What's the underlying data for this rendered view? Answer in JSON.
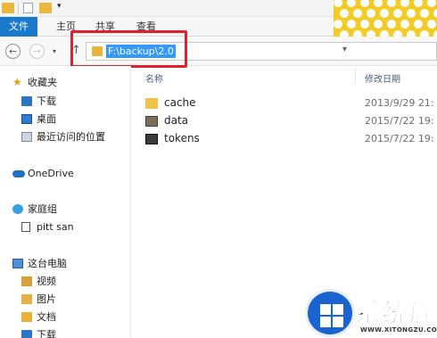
{
  "ribbon": {
    "tabs": [
      "文件",
      "主页",
      "共享",
      "查看"
    ]
  },
  "address": {
    "path": "F:\\backup\\2.0"
  },
  "nav_pane": {
    "favorites": {
      "label": "收藏夹",
      "items": [
        "下载",
        "桌面",
        "最近访问的位置"
      ]
    },
    "onedrive": "OneDrive",
    "homegroup": {
      "label": "家庭组",
      "items": [
        "pitt san"
      ]
    },
    "this_pc": {
      "label": "这台电脑",
      "items": [
        "视频",
        "图片",
        "文档",
        "下载"
      ]
    }
  },
  "columns": {
    "name": "名称",
    "date_modified": "修改日期"
  },
  "files": [
    {
      "name": "cache",
      "date": "2013/9/29 21:",
      "icon": "folder-icon"
    },
    {
      "name": "data",
      "date": "2015/7/22 19:",
      "icon": "data-file-icon"
    },
    {
      "name": "tokens",
      "date": "2015/7/22 19:",
      "icon": "tokens-file-icon"
    }
  ],
  "watermark": {
    "title": "系统族",
    "url": "WWW.XITONGZU.COM"
  },
  "colors": {
    "accent": "#1979ca",
    "highlight": "#e0212b",
    "selection": "#3399ff"
  }
}
